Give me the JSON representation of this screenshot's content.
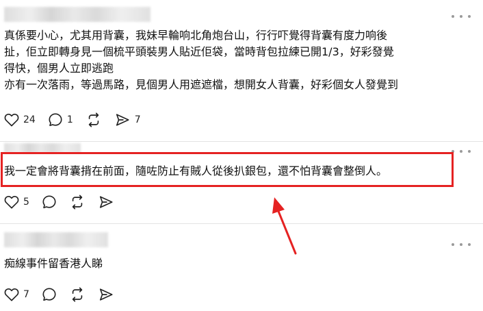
{
  "colors": {
    "annotation": "#e52222",
    "text": "#111111",
    "icon": "#222222",
    "divider": "#e3e3e3"
  },
  "posts": [
    {
      "text_lines": [
        "真係要小心，尤其用背囊，我妹早輪响北角炮台山，行行吓覺得背囊有度力响後",
        "扯，佢立即轉身見一個梳平頭裝男人貼近佢袋，當時背包拉練已開1/3，好彩發覺",
        "得快，個男人立即逃跑",
        "亦有一次落雨，等過馬路，見個男人用遮遮檔，想開女人背囊，好彩個女人發覺到"
      ],
      "likes": "24",
      "replies": "1",
      "shares": "7"
    },
    {
      "text_lines": [
        "我一定會將背囊揹在前面，隨咗防止有賊人從後扒銀包，還不怕背囊會整倒人。"
      ],
      "likes": "5"
    },
    {
      "text_lines": [
        "痴線事件留香港人睇"
      ],
      "likes": "7"
    }
  ],
  "icons": {
    "like": "heart-icon",
    "reply": "comment-bubble-icon",
    "repost": "repost-arrows-icon",
    "share": "send-icon",
    "more": "more-dots-icon",
    "annotation_arrow": "red-arrow-icon"
  }
}
